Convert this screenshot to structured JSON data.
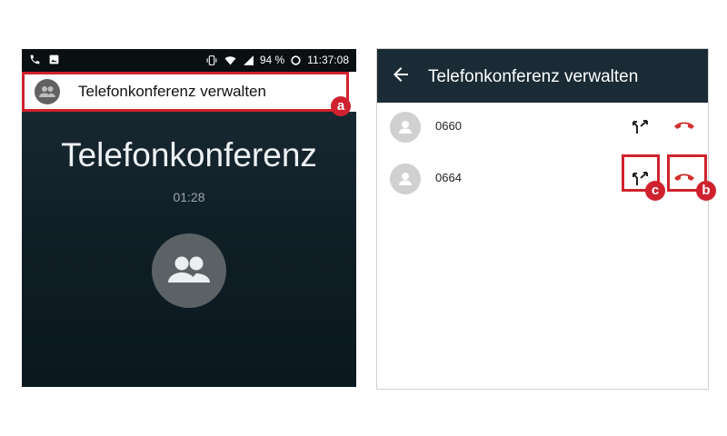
{
  "left_screen": {
    "status_bar": {
      "battery": "94 %",
      "time": "11:37:08"
    },
    "banner": {
      "label": "Telefonkonferenz verwalten"
    },
    "title": "Telefonkonferenz",
    "timer": "01:28"
  },
  "right_screen": {
    "app_bar": {
      "title": "Telefonkonferenz verwalten"
    },
    "participants": [
      {
        "number": "0660"
      },
      {
        "number": "0664"
      }
    ]
  },
  "annotations": {
    "a": "a",
    "b": "b",
    "c": "c"
  },
  "colors": {
    "accent_red": "#d0222e",
    "hangup_red": "#d32f2f",
    "call_bg": "#13232d",
    "app_bar": "#1a2b35"
  }
}
